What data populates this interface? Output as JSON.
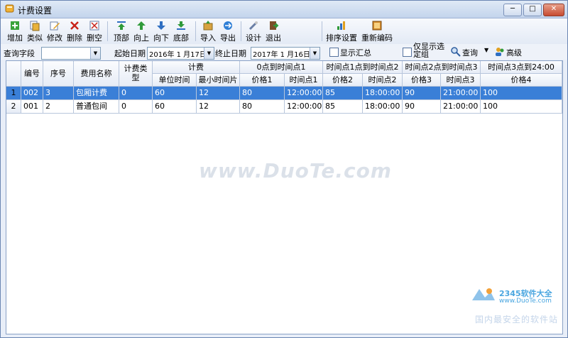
{
  "window": {
    "title": "计费设置",
    "minimize": "─",
    "maximize": "□",
    "close": "✕"
  },
  "toolbar": {
    "add": "增加",
    "similar": "类似",
    "edit": "修改",
    "delete": "删除",
    "clear": "删空",
    "top": "顶部",
    "up": "向上",
    "down": "向下",
    "bottom": "底部",
    "import": "导入",
    "export": "导出",
    "design": "设计",
    "exit": "退出",
    "sort_settings": "排序设置",
    "renumber": "重新编码"
  },
  "querybar": {
    "query_field_label": "查询字段",
    "query_field_value": "",
    "start_date_label": "起始日期",
    "start_date": "2016年 1 月17日",
    "end_date_label": "终止日期",
    "end_date": "2017年 1 月16日",
    "show_summary": "显示汇总",
    "show_selected_only": "仅显示选定组",
    "query_button": "查询",
    "advanced_button": "高级"
  },
  "grid": {
    "group_headers": {
      "billing": "计费",
      "period1": "0点到时间点1",
      "period2": "时间点1点到时间点2",
      "period3": "时间点2点到时间点3",
      "period4": "时间点3点到24:00"
    },
    "columns": {
      "code": "编号",
      "seq": "序号",
      "name": "费用名称",
      "type": "计费类型",
      "unit_time": "单位时间",
      "min_slice": "最小时间片",
      "price1": "价格1",
      "time1": "时间点1",
      "price2": "价格2",
      "time2": "时间点2",
      "price3": "价格3",
      "time3": "时间点3",
      "price4": "价格4"
    },
    "rows": [
      {
        "num": "1",
        "code": "002",
        "seq": "3",
        "name": "包厢计费",
        "type": "0",
        "unit_time": "60",
        "min_slice": "12",
        "price1": "80",
        "time1": "12:00:00",
        "price2": "85",
        "time2": "18:00:00",
        "price3": "90",
        "time3": "21:00:00",
        "price4": "100"
      },
      {
        "num": "2",
        "code": "001",
        "seq": "2",
        "name": "普通包间",
        "type": "0",
        "unit_time": "60",
        "min_slice": "12",
        "price1": "80",
        "time1": "12:00:00",
        "price2": "85",
        "time2": "18:00:00",
        "price3": "90",
        "time3": "21:00:00",
        "price4": "100"
      }
    ]
  },
  "watermark": {
    "text": "www.DuoTe.com",
    "logo_text": "2345软件大全",
    "logo_url": "www.DuoTe.com",
    "logo_tagline": "国内最安全的软件站"
  },
  "colors": {
    "selection": "#3a7fd7",
    "titlebar": "#c3d4ec"
  }
}
